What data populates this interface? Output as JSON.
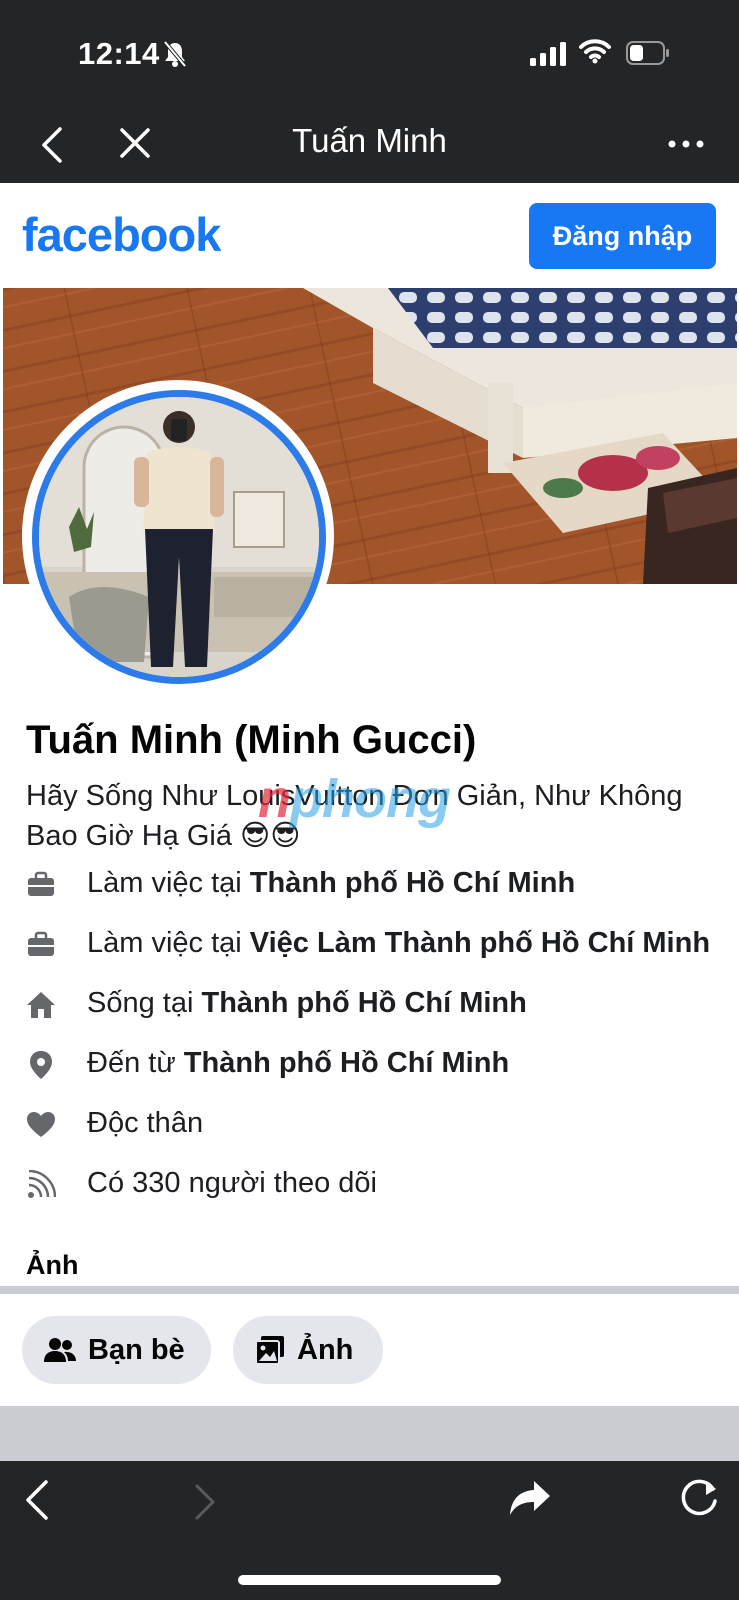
{
  "status_bar": {
    "time": "12:14"
  },
  "browser_bar": {
    "title": "Tuấn Minh"
  },
  "header": {
    "logo": "facebook",
    "login_label": "Đăng nhập"
  },
  "profile": {
    "name": "Tuấn Minh (Minh Gucci)",
    "bio": "Hãy Sống Như LouisVuitton Đơn Giản, Như Không Bao Giờ Hạ Giá 😎😎"
  },
  "details": [
    {
      "icon": "briefcase-icon",
      "prefix": "Làm việc tại ",
      "value": "Thành phố Hồ Chí Minh"
    },
    {
      "icon": "briefcase-icon",
      "prefix": "Làm việc tại ",
      "value": "Việc Làm Thành phố Hồ Chí Minh"
    },
    {
      "icon": "home-icon",
      "prefix": "Sống tại ",
      "value": "Thành phố Hồ Chí Minh"
    },
    {
      "icon": "location-pin-icon",
      "prefix": "Đến từ ",
      "value": "Thành phố Hồ Chí Minh"
    },
    {
      "icon": "heart-icon",
      "prefix": "Độc thân",
      "value": ""
    },
    {
      "icon": "rss-feed-icon",
      "prefix": "Có 330 người theo dõi",
      "value": ""
    }
  ],
  "photos_section": {
    "title": "Ảnh"
  },
  "tabs": {
    "friends": "Bạn bè",
    "photos": "Ảnh"
  },
  "watermark": {
    "part1": "n",
    "part2": "phong"
  },
  "colors": {
    "brand": "#1877f2",
    "dark_bar": "#242526",
    "chip_bg": "#e4e6eb"
  }
}
